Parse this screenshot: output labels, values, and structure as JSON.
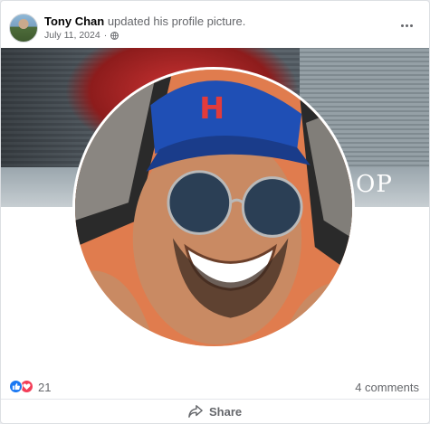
{
  "post": {
    "author": "Tony Chan",
    "action": "updated his profile picture.",
    "date": "July 11, 2024",
    "privacy_icon": "globe-icon",
    "more_icon": "more-options-icon"
  },
  "media": {
    "cover_text": "OP"
  },
  "reactions": {
    "icons": [
      "like-icon",
      "love-icon"
    ],
    "count": "21",
    "comments": "4 comments"
  },
  "actions": {
    "share_label": "Share"
  },
  "colors": {
    "like": "#1877f2",
    "love": "#f33e58",
    "secondary_text": "#65676b"
  }
}
